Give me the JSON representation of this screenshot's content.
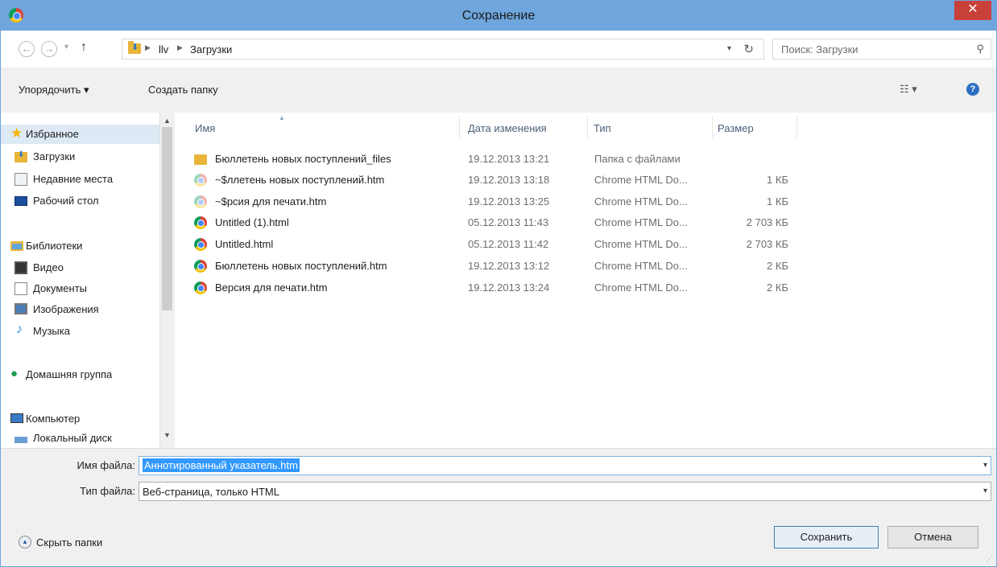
{
  "window": {
    "title": "Сохранение",
    "close_label": "✕"
  },
  "address": {
    "crumbs": [
      "llv",
      "Загрузки"
    ],
    "search_placeholder": "Поиск: Загрузки"
  },
  "toolbar": {
    "organize_label": "Упорядочить ▾",
    "new_folder_label": "Создать папку",
    "help_label": "?"
  },
  "nav": {
    "favorites": {
      "label": "Избранное",
      "items": [
        "Загрузки",
        "Недавние места",
        "Рабочий стол"
      ]
    },
    "libraries": {
      "label": "Библиотеки",
      "items": [
        "Видео",
        "Документы",
        "Изображения",
        "Музыка"
      ]
    },
    "homegroup": "Домашняя группа",
    "computer": {
      "label": "Компьютер",
      "items": [
        "Локальный диск"
      ]
    }
  },
  "columns": {
    "name": "Имя",
    "date": "Дата изменения",
    "type": "Тип",
    "size": "Размер"
  },
  "files": [
    {
      "name": "Бюллетень новых поступлений_files",
      "date": "19.12.2013 13:21",
      "type": "Папка с файлами",
      "size": "",
      "icon": "folder-icon"
    },
    {
      "name": "~$ллетень новых поступлений.htm",
      "date": "19.12.2013 13:18",
      "type": "Chrome HTML Do...",
      "size": "1 КБ",
      "icon": "chrome-icon"
    },
    {
      "name": "~$рсия для печати.htm",
      "date": "19.12.2013 13:25",
      "type": "Chrome HTML Do...",
      "size": "1 КБ",
      "icon": "chrome-icon"
    },
    {
      "name": "Untitled (1).html",
      "date": "05.12.2013 11:43",
      "type": "Chrome HTML Do...",
      "size": "2 703 КБ",
      "icon": "chrome-icon"
    },
    {
      "name": "Untitled.html",
      "date": "05.12.2013 11:42",
      "type": "Chrome HTML Do...",
      "size": "2 703 КБ",
      "icon": "chrome-icon"
    },
    {
      "name": "Бюллетень новых поступлений.htm",
      "date": "19.12.2013 13:12",
      "type": "Chrome HTML Do...",
      "size": "2 КБ",
      "icon": "chrome-icon"
    },
    {
      "name": "Версия для печати.htm",
      "date": "19.12.2013 13:24",
      "type": "Chrome HTML Do...",
      "size": "2 КБ",
      "icon": "chrome-icon"
    }
  ],
  "form": {
    "filename_label": "Имя файла:",
    "filename_value": "Аннотированный указатель.htm",
    "filetype_label": "Тип файла:",
    "filetype_value": "Веб-страница, только HTML",
    "hide_folders_label": "Скрыть папки",
    "save_label": "Сохранить",
    "cancel_label": "Отмена"
  },
  "colors": {
    "titlebar": "#6ea6dd",
    "close": "#c7413a",
    "selection": "#3399ff"
  }
}
